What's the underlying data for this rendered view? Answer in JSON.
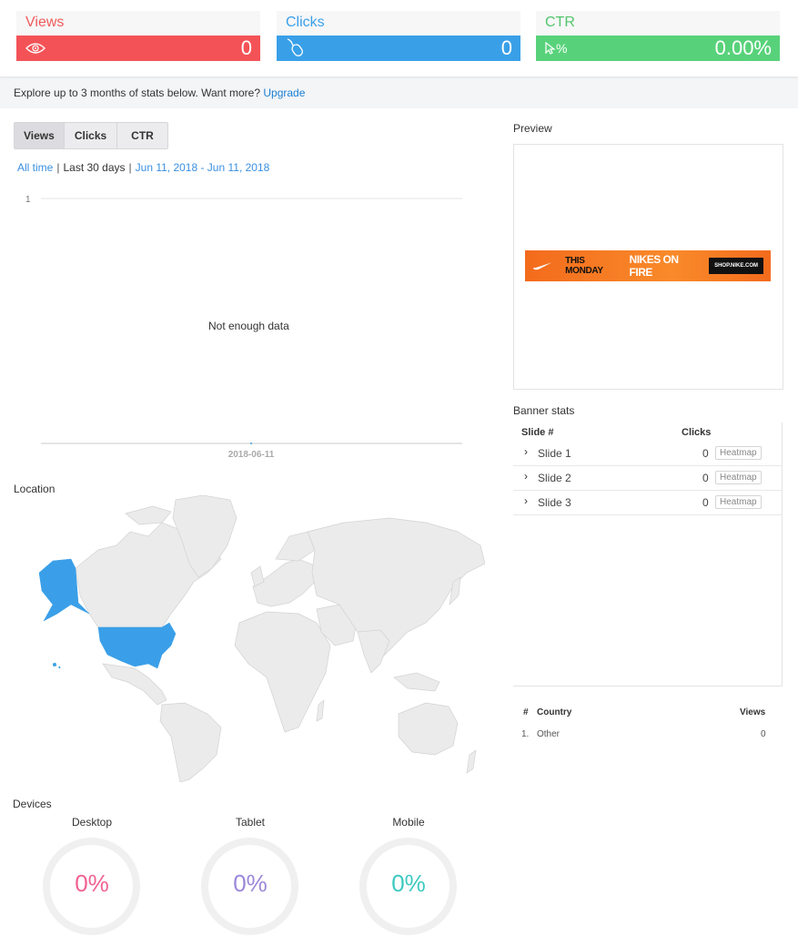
{
  "kpis": {
    "views": {
      "label": "Views",
      "value": "0",
      "icon": "eye-icon",
      "color": "#f35357"
    },
    "clicks": {
      "label": "Clicks",
      "value": "0",
      "icon": "mouse-icon",
      "color": "#39a0e8"
    },
    "ctr": {
      "label": "CTR",
      "value": "0.00%",
      "icon": "cursor-percent-icon",
      "icon_text": "%",
      "color": "#58d27a"
    }
  },
  "explore": {
    "text": "Explore up to 3 months of stats below. Want more?",
    "link": "Upgrade"
  },
  "tabs": [
    "Views",
    "Clicks",
    "CTR"
  ],
  "range": {
    "all_time": "All time",
    "last30": "Last 30 days",
    "dates": "Jun 11, 2018 - Jun 11, 2018"
  },
  "chart": {
    "y_tick": "1",
    "x_tick": "2018-06-11",
    "empty_message": "Not enough data"
  },
  "chart_data": {
    "type": "line",
    "x": [
      "2018-06-11"
    ],
    "series": [
      {
        "values": [
          0
        ]
      }
    ],
    "ylim": [
      0,
      1
    ],
    "grid": true
  },
  "sections": {
    "location": "Location",
    "devices": "Devices",
    "preview": "Preview",
    "banner_stats": "Banner stats"
  },
  "banner": {
    "text1": "THIS MONDAY",
    "text2": "NIKES ON FIRE",
    "text3": "SHOP.NIKE.COM"
  },
  "slides": {
    "headers": {
      "slide": "Slide #",
      "clicks": "Clicks"
    },
    "rows": [
      {
        "name": "Slide 1",
        "clicks": "0",
        "action": "Heatmap"
      },
      {
        "name": "Slide 2",
        "clicks": "0",
        "action": "Heatmap"
      },
      {
        "name": "Slide 3",
        "clicks": "0",
        "action": "Heatmap"
      }
    ]
  },
  "countries": {
    "headers": {
      "num": "#",
      "country": "Country",
      "views": "Views"
    },
    "rows": [
      {
        "num": "1.",
        "country": "Other",
        "views": "0"
      }
    ]
  },
  "devices": [
    {
      "label": "Desktop",
      "value": "0%",
      "color": "#f06292"
    },
    {
      "label": "Tablet",
      "value": "0%",
      "color": "#9b87d9"
    },
    {
      "label": "Mobile",
      "value": "0%",
      "color": "#3cc9c0"
    }
  ],
  "map": {
    "highlight_color": "#3a9fe8",
    "highlighted": "United States"
  }
}
